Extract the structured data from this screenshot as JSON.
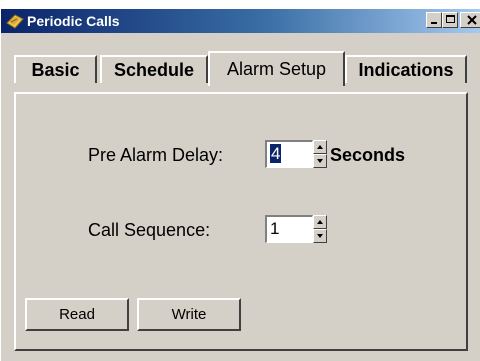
{
  "window": {
    "title": "Periodic Calls",
    "icon": "periodic-calls-app-icon",
    "controls": [
      "minimize-icon",
      "maximize-icon",
      "close-icon"
    ]
  },
  "tabs": [
    {
      "label": "Basic",
      "selected": false
    },
    {
      "label": "Schedule",
      "selected": false
    },
    {
      "label": "Alarm Setup",
      "selected": true
    },
    {
      "label": "Indications",
      "selected": false
    }
  ],
  "alarm_setup": {
    "pre_alarm_delay": {
      "label": "Pre Alarm Delay:",
      "value": "4",
      "unit": "Seconds"
    },
    "call_sequence": {
      "label": "Call Sequence:",
      "value": "1"
    }
  },
  "buttons": {
    "read_label": "Read",
    "write_label": "Write"
  },
  "colors": {
    "title_gradient_start": "#0a246a",
    "title_gradient_end": "#a6caf0",
    "face": "#d4d0c8",
    "selection": "#0a246a"
  }
}
